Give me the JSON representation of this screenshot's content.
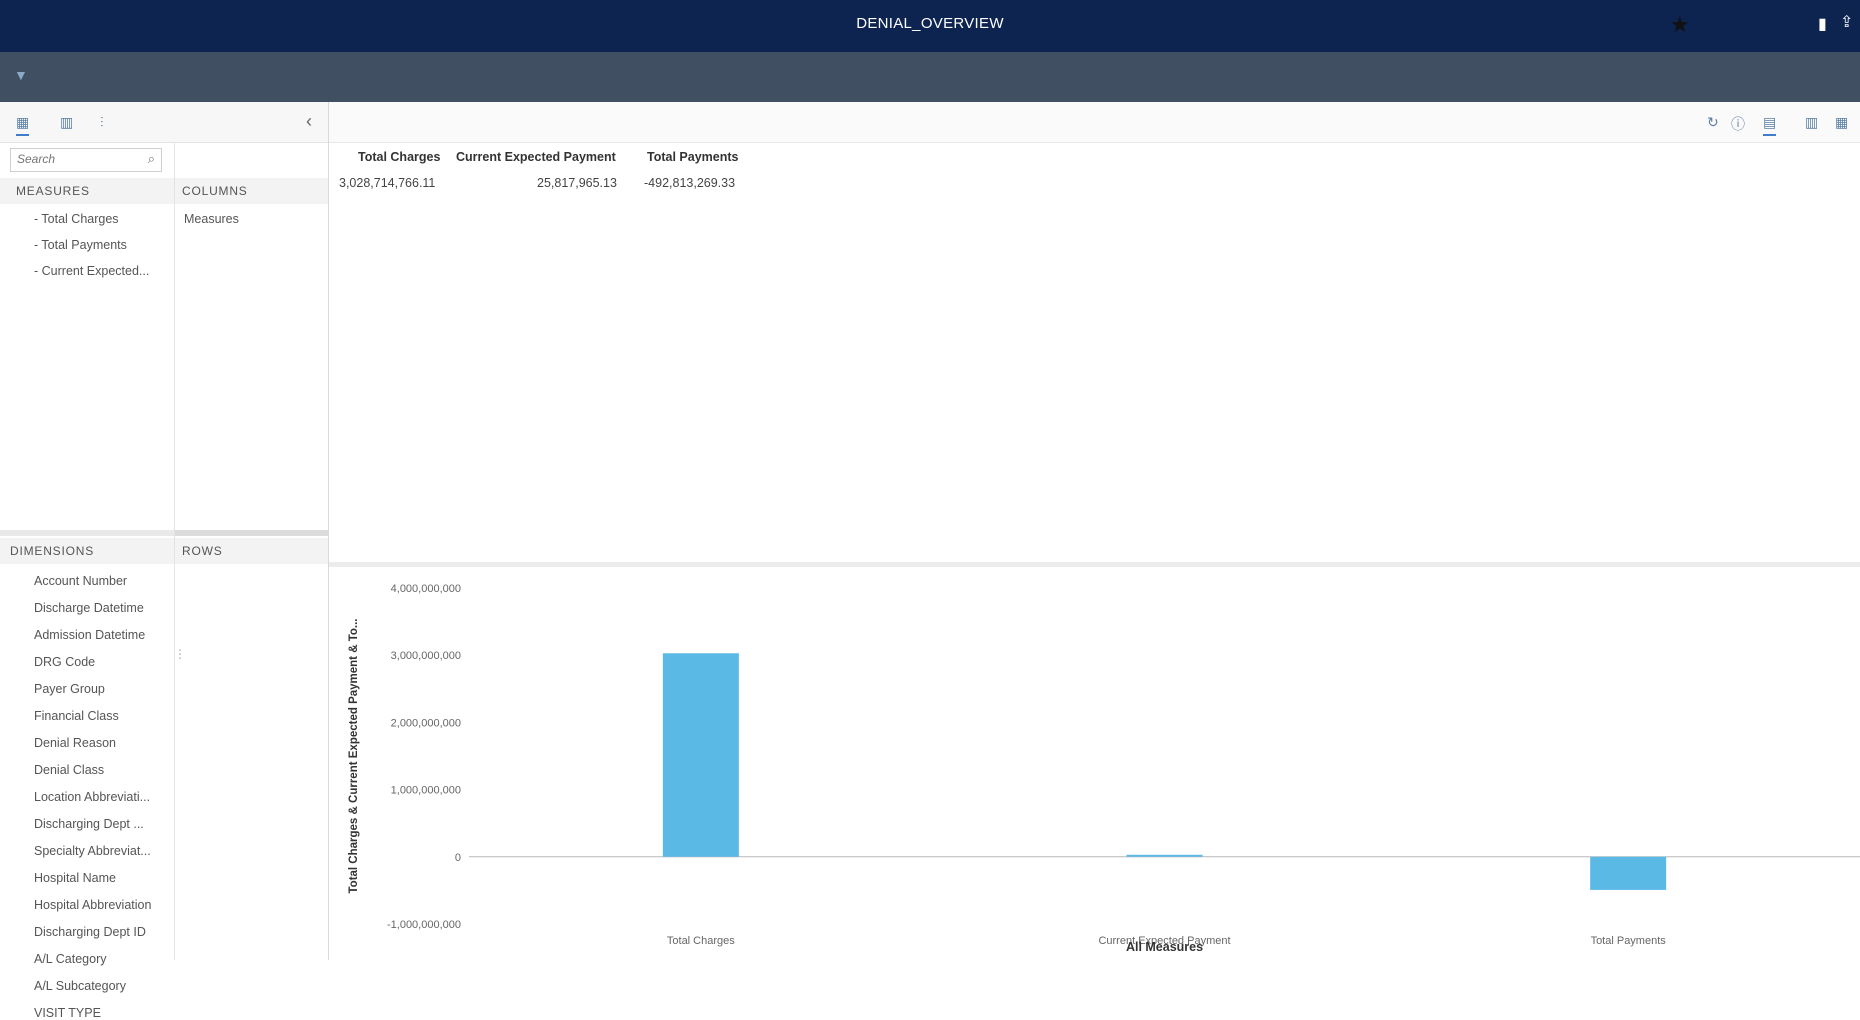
{
  "header": {
    "title": "DENIAL_OVERVIEW"
  },
  "left_panel": {
    "search_placeholder": "Search",
    "measures": {
      "heading": "MEASURES",
      "items": [
        "Total Charges",
        "Total Payments",
        "Current Expected..."
      ]
    },
    "columns": {
      "heading": "COLUMNS",
      "items": [
        "Measures"
      ]
    },
    "dimensions": {
      "heading": "DIMENSIONS",
      "items": [
        "Account Number",
        "Discharge Datetime",
        "Admission Datetime",
        "DRG Code",
        "Payer Group",
        "Financial Class",
        "Denial Reason",
        "Denial Class",
        "Location Abbreviati...",
        "Discharging Dept ...",
        "Specialty Abbreviat...",
        "Hospital Name",
        "Hospital Abbreviation",
        "Discharging Dept ID",
        "A/L Category",
        "A/L Subcategory",
        "VISIT TYPE"
      ]
    },
    "rows": {
      "heading": "ROWS"
    }
  },
  "table": {
    "headers": [
      "Total Charges",
      "Current Expected Payment",
      "Total Payments"
    ],
    "values": [
      "3,028,714,766.11",
      "25,817,965.13",
      "-492,813,269.33"
    ]
  },
  "chart_data": {
    "type": "bar",
    "categories": [
      "Total Charges",
      "Current Expected Payment",
      "Total Payments"
    ],
    "values": [
      3028714766.11,
      25817965.13,
      -492813269.33
    ],
    "xlabel": "All Measures",
    "ylabel": "Total Charges & Current Expected Payment & To...",
    "ylim": [
      -1000000000,
      4000000000
    ],
    "yticks": [
      -1000000000,
      0,
      1000000000,
      2000000000,
      3000000000,
      4000000000
    ],
    "ytick_labels": [
      "-1,000,000,000",
      "0",
      "1,000,000,000",
      "2,000,000,000",
      "3,000,000,000",
      "4,000,000,000"
    ],
    "bar_color": "#5bb9e6",
    "grid": false
  },
  "colors": {
    "header_bg": "#0d2350",
    "filter_bg": "#414f62",
    "accent": "#3d7dca"
  }
}
